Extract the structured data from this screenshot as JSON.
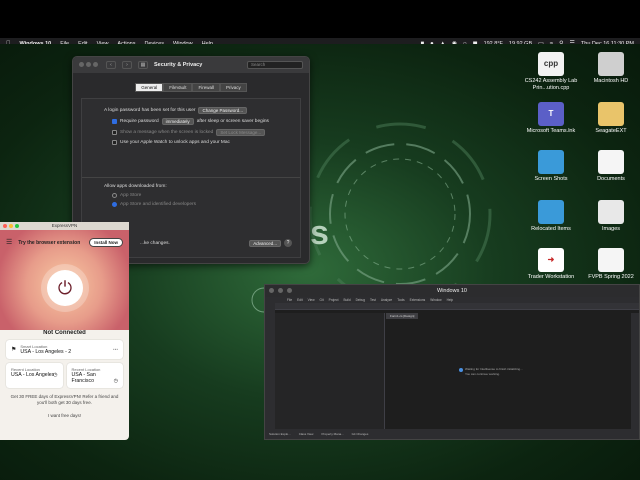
{
  "menubar": {
    "app": "Windows 10",
    "items": [
      "File",
      "Edit",
      "View",
      "Actions",
      "Devices",
      "Window",
      "Help"
    ],
    "temperature": "192.8°F",
    "storage": "19.92 GB",
    "datetime": "Thu Dec 16  11:30 PM"
  },
  "desktop_icons": [
    {
      "label": "CS242 Assembly Lab Prin...ution.cpp",
      "icon": "cpp-file-icon",
      "glyph": "cpp"
    },
    {
      "label": "Macintosh HD",
      "icon": "hard-drive-icon",
      "glyph": ""
    },
    {
      "label": "Microsoft Teams.lnk",
      "icon": "teams-icon",
      "glyph": "T"
    },
    {
      "label": "SeagateEXT",
      "icon": "external-drive-icon",
      "glyph": ""
    },
    {
      "label": "Screen Shots",
      "icon": "folder-icon",
      "glyph": ""
    },
    {
      "label": "Documents",
      "icon": "document-icon",
      "glyph": ""
    },
    {
      "label": "Relocated Items",
      "icon": "folder-icon",
      "glyph": ""
    },
    {
      "label": "Images",
      "icon": "image-file-icon",
      "glyph": ""
    },
    {
      "label": "Trader Workstation",
      "icon": "trader-workstation-icon",
      "glyph": ""
    },
    {
      "label": "FVPB Spring 2022",
      "icon": "document-icon",
      "glyph": ""
    }
  ],
  "security": {
    "title": "Security & Privacy",
    "search_placeholder": "Search",
    "tabs": [
      "General",
      "FileVault",
      "Firewall",
      "Privacy"
    ],
    "login_text": "A login password has been set for this user",
    "change_password": "Change Password...",
    "require_password": "Require password",
    "require_value": "immediately",
    "require_suffix": "after sleep or screen saver begins",
    "show_message": "Show a message when the screen is locked",
    "set_lock_message": "Set Lock Message...",
    "apple_watch": "Use your Apple Watch to unlock apps and your Mac",
    "allow_apps": "Allow apps downloaded from:",
    "app_store": "App Store",
    "app_store_identified": "App Store and identified developers",
    "footer_text": "...ke changes.",
    "advanced": "Advanced...",
    "help": "?"
  },
  "vpn": {
    "title": "ExpressVPN",
    "extension_text": "Try the browser extension",
    "install_now": "Install Now",
    "status": "Not Connected",
    "smart_label": "Smart Location",
    "smart_value": "USA - Los Angeles - 2",
    "recent1_label": "Recent Location",
    "recent1_value": "USA - Los Angeles",
    "recent2_label": "Recent Location",
    "recent2_value": "USA - San Francisco",
    "promo": "Get 30 FREE days of ExpressVPN! Refer a friend and you'll both get 30 days free.",
    "promo_link": "I want free days!"
  },
  "vm": {
    "title": "Windows 10",
    "menu": [
      "File",
      "Edit",
      "View",
      "Git",
      "Project",
      "Build",
      "Debug",
      "Test",
      "Analyze",
      "Tools",
      "Extensions",
      "Window",
      "Help"
    ],
    "tab": "Form1.cs [Design]",
    "message": "Waiting for Intellisense to finish initializing...",
    "message2": "You can continue working.",
    "status_items": [
      "Solution Explo...",
      "Class View",
      "Property Mana...",
      "Git Changes"
    ]
  }
}
